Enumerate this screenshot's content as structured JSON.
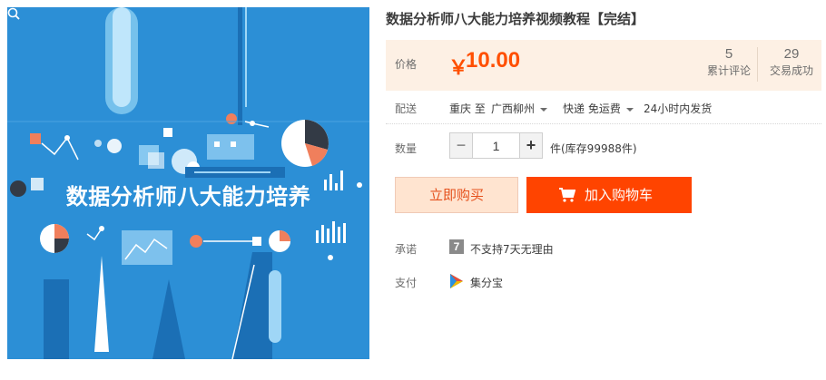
{
  "product": {
    "title": "数据分析师八大能力培养视频教程【完结】",
    "image": {
      "banner_text": "数据分析师八大能力培养"
    }
  },
  "price": {
    "label": "价格",
    "currency_symbol": "￥",
    "value": "10.00",
    "color": "#ff4f00"
  },
  "stats": {
    "comments": {
      "count": "5",
      "label": "累计评论"
    },
    "sales": {
      "count": "29",
      "label": "交易成功"
    }
  },
  "delivery": {
    "label": "配送",
    "from": "重庆 至",
    "to": "广西柳州",
    "method": "快递 免运费",
    "ship_time": "24小时内发货"
  },
  "quantity": {
    "label": "数量",
    "minus": "−",
    "value": "1",
    "plus": "+",
    "stock_text": "件(库存99988件)"
  },
  "actions": {
    "buy_now": "立即购买",
    "add_to_cart": "加入购物车",
    "cart_color": "#ff4400"
  },
  "promise": {
    "label": "承诺",
    "badge": "7",
    "text": "不支持7天无理由"
  },
  "payment": {
    "label": "支付",
    "icon": "jifenbao-icon",
    "text": "集分宝"
  }
}
